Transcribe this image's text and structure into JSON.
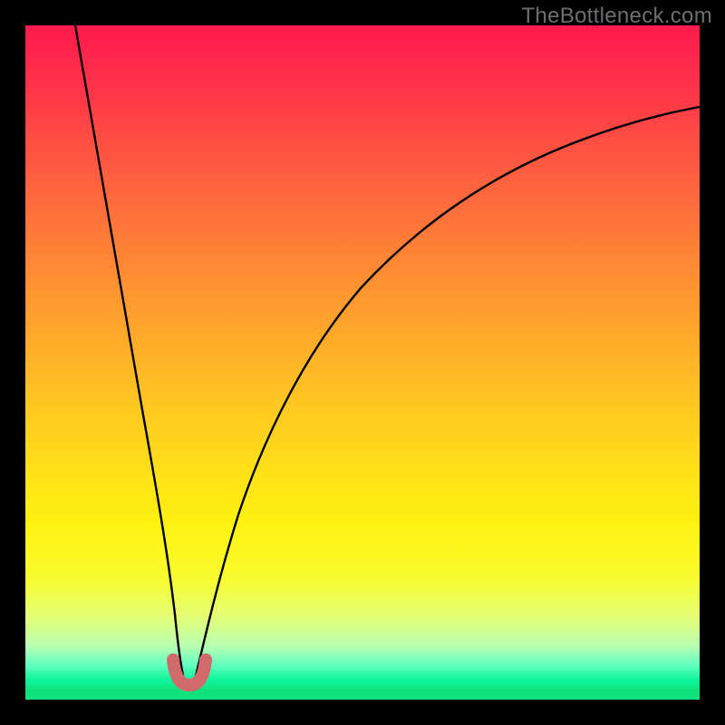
{
  "watermark": "TheBottleneck.com",
  "colors": {
    "background": "#000000",
    "gradient_top": "#ff1a4d",
    "gradient_mid": "#ffe018",
    "gradient_bottom": "#0fe27c",
    "curve": "#000000",
    "well_marker": "#d16a6a",
    "watermark_text": "#6e6e6e"
  },
  "chart_data": {
    "type": "line",
    "title": "",
    "xlabel": "",
    "ylabel": "",
    "xlim": [
      0,
      100
    ],
    "ylim": [
      0,
      100
    ],
    "notes": "Bottleneck-style plot: V-shaped curve with minimum near x≈23. Left branch starts high (y≈100 at x≈7) and drops steeply to the trough; right branch rises with diminishing slope toward y≈88 at x=100. Short red U marker at trough. Solid green baseline strip at y≈0..2.",
    "series": [
      {
        "name": "bottleneck-curve",
        "x": [
          7,
          10,
          13,
          16,
          19,
          21,
          22,
          23,
          24,
          25,
          27,
          30,
          35,
          40,
          50,
          60,
          70,
          80,
          90,
          100
        ],
        "y": [
          100,
          84,
          66,
          48,
          28,
          12,
          5,
          2,
          5,
          9,
          18,
          30,
          44,
          54,
          67,
          75,
          80,
          84,
          86,
          88
        ]
      },
      {
        "name": "trough-marker",
        "x": [
          21.5,
          22.5,
          23.5,
          24.5
        ],
        "y": [
          7,
          3,
          3,
          7
        ]
      },
      {
        "name": "green-baseline",
        "x": [
          0,
          100
        ],
        "y": [
          1,
          1
        ]
      }
    ]
  }
}
